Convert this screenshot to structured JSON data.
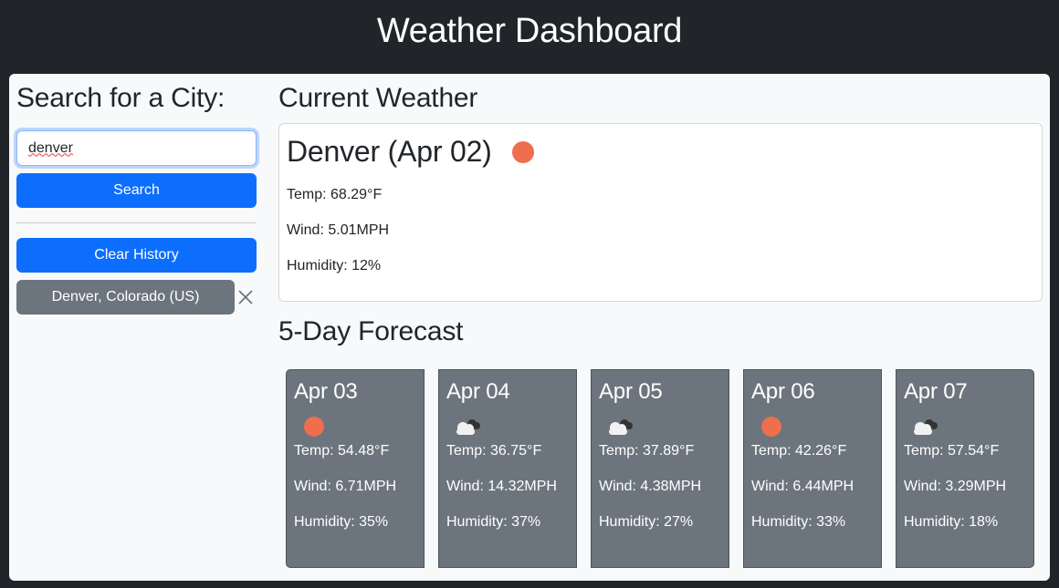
{
  "header": {
    "title": "Weather Dashboard"
  },
  "sidebar": {
    "heading": "Search for a City:",
    "search_input": {
      "value": "denver",
      "placeholder": ""
    },
    "search_button": "Search",
    "clear_history_button": "Clear History",
    "history": [
      {
        "label": "Denver, Colorado (US)",
        "remove_icon": "close-icon"
      }
    ]
  },
  "current": {
    "heading": "Current Weather",
    "title": "Denver (Apr 02)",
    "icon": "sun-icon",
    "temp": "Temp: 68.29°F",
    "wind": "Wind: 5.01MPH",
    "humidity": "Humidity: 12%"
  },
  "forecast": {
    "heading": "5-Day Forecast",
    "days": [
      {
        "date": "Apr 03",
        "icon": "sun-icon",
        "temp": "Temp: 54.48°F",
        "wind": "Wind: 6.71MPH",
        "humidity": "Humidity: 35%"
      },
      {
        "date": "Apr 04",
        "icon": "cloud-icon",
        "temp": "Temp: 36.75°F",
        "wind": "Wind: 14.32MPH",
        "humidity": "Humidity: 37%"
      },
      {
        "date": "Apr 05",
        "icon": "cloud-icon",
        "temp": "Temp: 37.89°F",
        "wind": "Wind: 4.38MPH",
        "humidity": "Humidity: 27%"
      },
      {
        "date": "Apr 06",
        "icon": "sun-icon",
        "temp": "Temp: 42.26°F",
        "wind": "Wind: 6.44MPH",
        "humidity": "Humidity: 33%"
      },
      {
        "date": "Apr 07",
        "icon": "cloud-icon",
        "temp": "Temp: 57.54°F",
        "wind": "Wind: 3.29MPH",
        "humidity": "Humidity: 18%"
      }
    ]
  },
  "colors": {
    "header_bg": "#212529",
    "primary": "#0d6efd",
    "secondary": "#6c757d",
    "sun": "#ee6e4d"
  }
}
